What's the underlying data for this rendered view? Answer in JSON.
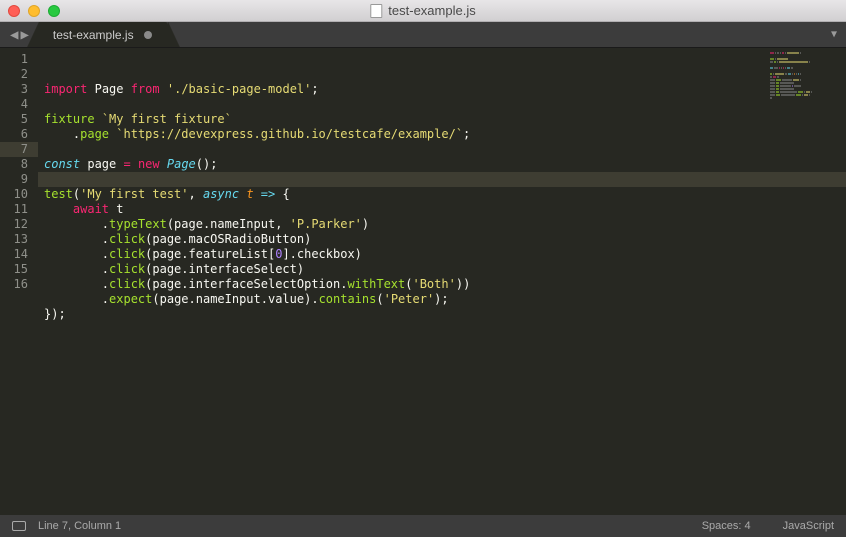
{
  "window": {
    "title": "test-example.js"
  },
  "tab": {
    "label": "test-example.js"
  },
  "statusbar": {
    "position": "Line 7, Column 1",
    "spaces": "Spaces: 4",
    "syntax": "JavaScript"
  },
  "code": {
    "lines": [
      [
        {
          "c": "kw-red",
          "t": "import"
        },
        {
          "c": "plain",
          "t": " "
        },
        {
          "c": "plain",
          "t": "Page"
        },
        {
          "c": "plain",
          "t": " "
        },
        {
          "c": "kw-red",
          "t": "from"
        },
        {
          "c": "plain",
          "t": " "
        },
        {
          "c": "str",
          "t": "'./basic-page-model'"
        },
        {
          "c": "plain",
          "t": ";"
        }
      ],
      [],
      [
        {
          "c": "fn-green",
          "t": "fixture"
        },
        {
          "c": "plain",
          "t": " "
        },
        {
          "c": "str",
          "t": "`My first fixture`"
        }
      ],
      [
        {
          "c": "plain",
          "t": "    ."
        },
        {
          "c": "fn-green",
          "t": "page"
        },
        {
          "c": "plain",
          "t": " "
        },
        {
          "c": "str",
          "t": "`https://devexpress.github.io/testcafe/example/`"
        },
        {
          "c": "plain",
          "t": ";"
        }
      ],
      [],
      [
        {
          "c": "kw-blue",
          "t": "const"
        },
        {
          "c": "plain",
          "t": " page "
        },
        {
          "c": "kw-red",
          "t": "="
        },
        {
          "c": "plain",
          "t": " "
        },
        {
          "c": "kw-red",
          "t": "new"
        },
        {
          "c": "plain",
          "t": " "
        },
        {
          "c": "kw-blue",
          "t": "Page"
        },
        {
          "c": "plain",
          "t": "();"
        }
      ],
      [],
      [
        {
          "c": "fn-green",
          "t": "test"
        },
        {
          "c": "plain",
          "t": "("
        },
        {
          "c": "str",
          "t": "'My first test'"
        },
        {
          "c": "plain",
          "t": ", "
        },
        {
          "c": "kw-blue",
          "t": "async"
        },
        {
          "c": "plain",
          "t": " "
        },
        {
          "c": "pname",
          "t": "t"
        },
        {
          "c": "plain",
          "t": " "
        },
        {
          "c": "kw-blue",
          "t": "=>"
        },
        {
          "c": "plain",
          "t": " {"
        }
      ],
      [
        {
          "c": "plain",
          "t": "    "
        },
        {
          "c": "kw-red",
          "t": "await"
        },
        {
          "c": "plain",
          "t": " t"
        }
      ],
      [
        {
          "c": "plain",
          "t": "        ."
        },
        {
          "c": "fn-green",
          "t": "typeText"
        },
        {
          "c": "plain",
          "t": "(page.nameInput, "
        },
        {
          "c": "str",
          "t": "'P.Parker'"
        },
        {
          "c": "plain",
          "t": ")"
        }
      ],
      [
        {
          "c": "plain",
          "t": "        ."
        },
        {
          "c": "fn-green",
          "t": "click"
        },
        {
          "c": "plain",
          "t": "(page.macOSRadioButton)"
        }
      ],
      [
        {
          "c": "plain",
          "t": "        ."
        },
        {
          "c": "fn-green",
          "t": "click"
        },
        {
          "c": "plain",
          "t": "(page.featureList["
        },
        {
          "c": "num",
          "t": "0"
        },
        {
          "c": "plain",
          "t": "].checkbox)"
        }
      ],
      [
        {
          "c": "plain",
          "t": "        ."
        },
        {
          "c": "fn-green",
          "t": "click"
        },
        {
          "c": "plain",
          "t": "(page.interfaceSelect)"
        }
      ],
      [
        {
          "c": "plain",
          "t": "        ."
        },
        {
          "c": "fn-green",
          "t": "click"
        },
        {
          "c": "plain",
          "t": "(page.interfaceSelectOption."
        },
        {
          "c": "fn-green",
          "t": "withText"
        },
        {
          "c": "plain",
          "t": "("
        },
        {
          "c": "str",
          "t": "'Both'"
        },
        {
          "c": "plain",
          "t": "))"
        }
      ],
      [
        {
          "c": "plain",
          "t": "        ."
        },
        {
          "c": "fn-green",
          "t": "expect"
        },
        {
          "c": "plain",
          "t": "(page.nameInput.value)."
        },
        {
          "c": "fn-green",
          "t": "contains"
        },
        {
          "c": "plain",
          "t": "("
        },
        {
          "c": "str",
          "t": "'Peter'"
        },
        {
          "c": "plain",
          "t": ");"
        }
      ],
      [
        {
          "c": "plain",
          "t": "});"
        }
      ]
    ],
    "currentLine": 7
  }
}
